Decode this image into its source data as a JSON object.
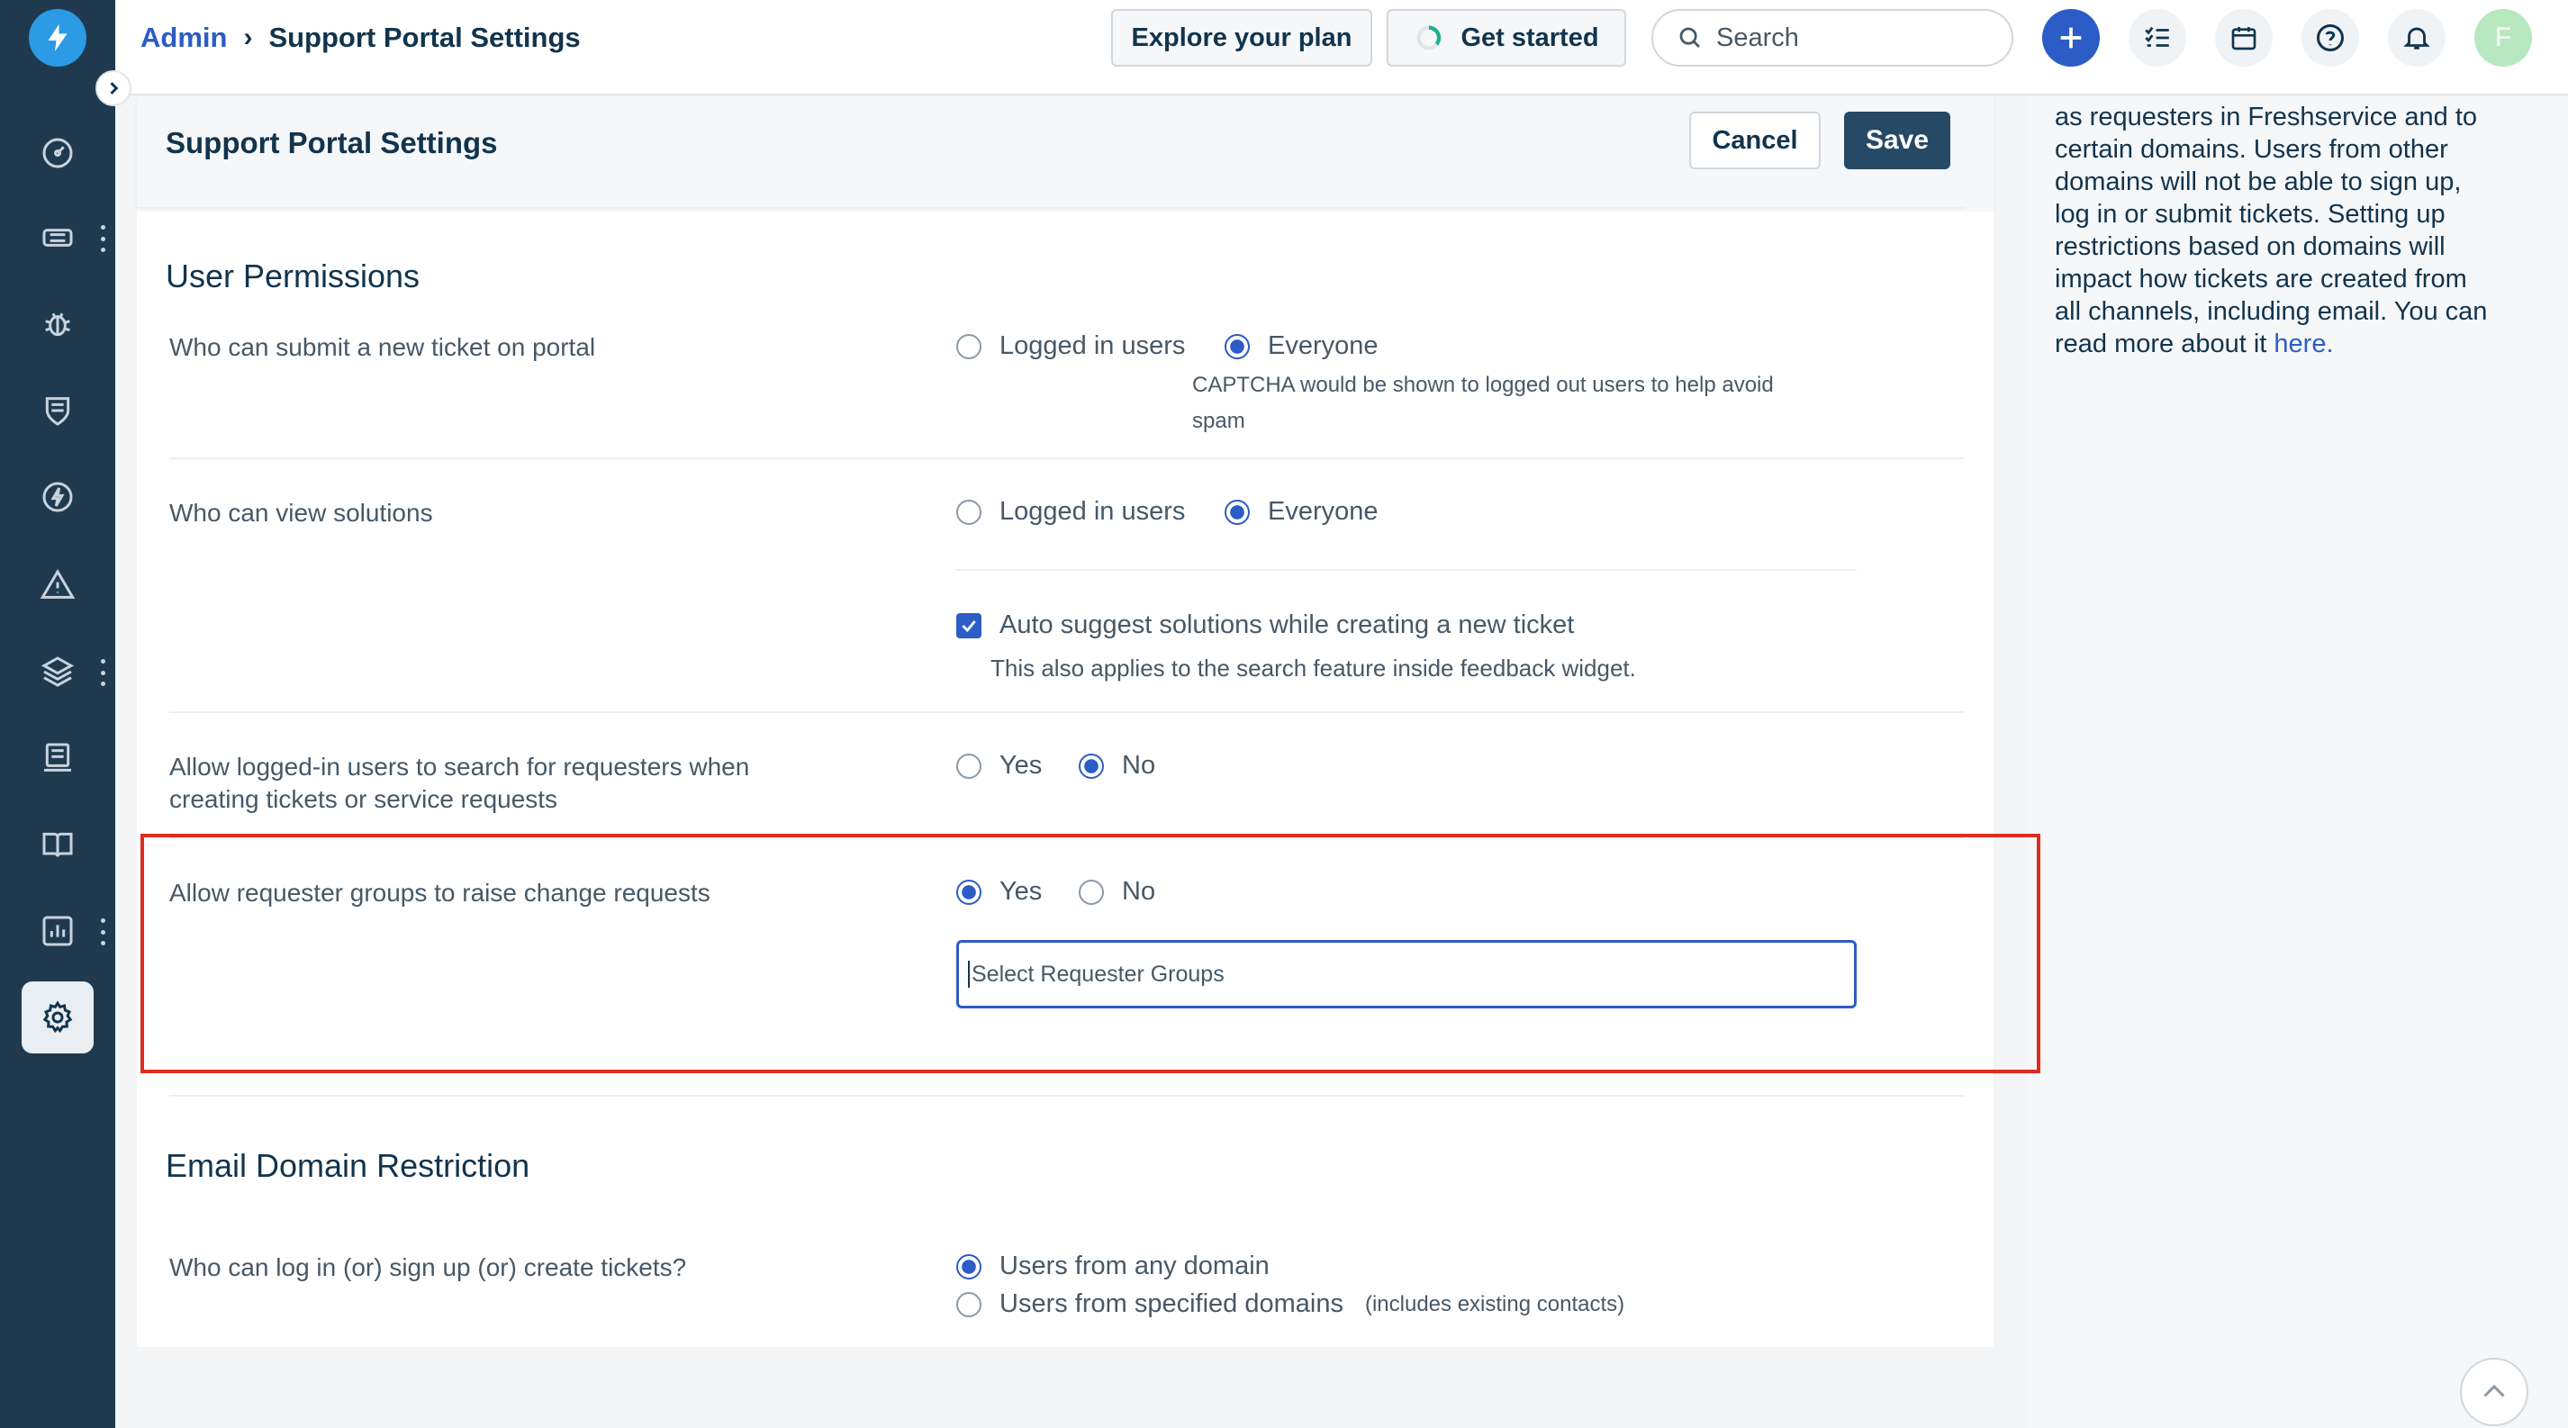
{
  "topbar": {
    "breadcrumb_root": "Admin",
    "breadcrumb_sep": "›",
    "breadcrumb_current": "Support Portal Settings",
    "explore_plan": "Explore your plan",
    "get_started": "Get started",
    "search_placeholder": "Search",
    "avatar_initial": "F"
  },
  "panel": {
    "title": "Support Portal Settings",
    "cancel": "Cancel",
    "save": "Save"
  },
  "user_permissions": {
    "heading": "User Permissions",
    "submit_ticket": {
      "label": "Who can submit a new ticket on portal",
      "options": [
        "Logged in users",
        "Everyone"
      ],
      "selected": "Everyone",
      "hint_line1": "CAPTCHA would be shown to logged out users to help avoid",
      "hint_line2": "spam"
    },
    "view_solutions": {
      "label": "Who can view solutions",
      "options": [
        "Logged in users",
        "Everyone"
      ],
      "selected": "Everyone",
      "auto_suggest_label": "Auto suggest solutions while creating a new ticket",
      "auto_suggest_checked": true,
      "auto_suggest_hint": "This also applies to the search feature inside feedback widget."
    },
    "search_requesters": {
      "label_line1": "Allow logged-in users to search for requesters when",
      "label_line2": "creating tickets or service requests",
      "options": [
        "Yes",
        "No"
      ],
      "selected": "No"
    },
    "change_requests": {
      "label": "Allow requester groups to raise change requests",
      "options": [
        "Yes",
        "No"
      ],
      "selected": "Yes",
      "select_placeholder": "Select Requester Groups"
    }
  },
  "email_domain": {
    "heading": "Email Domain Restriction",
    "label": "Who can log in (or) sign up (or) create tickets?",
    "option_any": "Users from any domain",
    "option_specified": "Users from specified domains",
    "option_specified_note": "(includes existing contacts)",
    "selected": "Users from any domain"
  },
  "help": {
    "lines": [
      "as requesters in Freshservice and to",
      "certain domains. Users from other",
      "domains will not be able to sign up,",
      "log in or submit tickets. Setting up",
      "restrictions based on domains will",
      "impact how tickets are created from",
      "all channels, including email. You can"
    ],
    "last_line_prefix": "read more about it ",
    "link": "here."
  },
  "colors": {
    "nav_bg": "#1f3a4f",
    "accent": "#2c5cc5",
    "save_bg": "#264966",
    "highlight": "#e02b20"
  },
  "icons": [
    "logo-bolt-icon",
    "dashboard-icon",
    "tickets-icon",
    "problems-icon",
    "changes-icon",
    "releases-icon",
    "alerts-icon",
    "assets-icon",
    "projects-icon",
    "solutions-icon",
    "reports-icon",
    "admin-gear-icon"
  ]
}
